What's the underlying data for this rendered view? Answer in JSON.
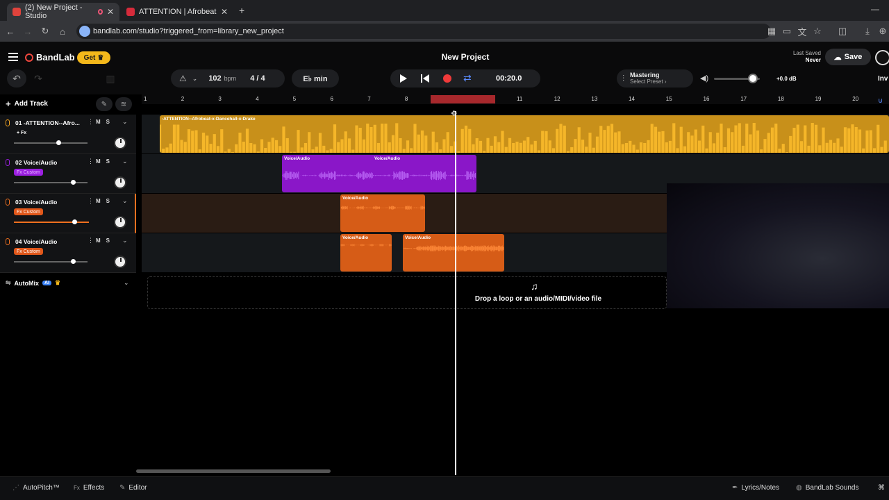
{
  "browser": {
    "tabs": [
      {
        "title": "(2) New Project - Studio",
        "active": true
      },
      {
        "title": "ATTENTION | Afrobeat x Da",
        "active": false
      }
    ],
    "new_tab": "+",
    "url": "bandlab.com/studio?triggered_from=library_new_project"
  },
  "app": {
    "logo": "BandLab",
    "get_label": "Get",
    "project_title": "New Project",
    "last_saved_label": "Last Saved",
    "last_saved_value": "Never",
    "save_label": "Save",
    "invite_label": "Inv"
  },
  "transport": {
    "bpm_value": "102",
    "bpm_unit": "bpm",
    "time_sig": "4 / 4",
    "key": "E♭ min",
    "time": "00:20.0",
    "mastering_label": "Mastering",
    "mastering_preset": "Select Preset ›",
    "volume_db": "+0.0 dB",
    "volume_level": 0.85
  },
  "tracks_panel": {
    "add_track": "Add Track",
    "automix": "AutoMix",
    "automix_badge": "AI"
  },
  "tracks": [
    {
      "number": "01",
      "name": "-ATTENTION--Afro...",
      "fx": "+ Fx",
      "fx_style": "plain",
      "volume": 0.6,
      "color": "#f5a623"
    },
    {
      "number": "02",
      "name": "Voice/Audio",
      "fx": "Fx Custom",
      "fx_style": "purple",
      "volume": 0.8,
      "color": "#9b1fe0"
    },
    {
      "number": "03",
      "name": "Voice/Audio",
      "fx": "Fx Custom",
      "fx_style": "orange",
      "volume": 0.81,
      "color": "#f0701f"
    },
    {
      "number": "04",
      "name": "Voice/Audio",
      "fx": "Fx Custom",
      "fx_style": "orange",
      "volume": 0.8,
      "color": "#f0701f"
    }
  ],
  "ruler": [
    "1",
    "2",
    "3",
    "4",
    "5",
    "6",
    "7",
    "8",
    "9",
    "10",
    "11",
    "12",
    "13",
    "14",
    "15",
    "16",
    "17",
    "18",
    "19",
    "20"
  ],
  "clips": {
    "c1": "-ATTENTION--Afrobeat-x-Dancehall-x-Drake",
    "c2a": "Voice/Audio",
    "c2b": "Voice/Audio",
    "c3": "Voice/Audio",
    "c4a": "Voice/Audio",
    "c4b": "Voice/Audio"
  },
  "drop_text": "Drop a loop or an audio/MIDI/video file",
  "bottom": {
    "autopitch": "AutoPitch™",
    "effects": "Effects",
    "editor": "Editor",
    "lyrics": "Lyrics/Notes",
    "sounds": "BandLab Sounds"
  }
}
